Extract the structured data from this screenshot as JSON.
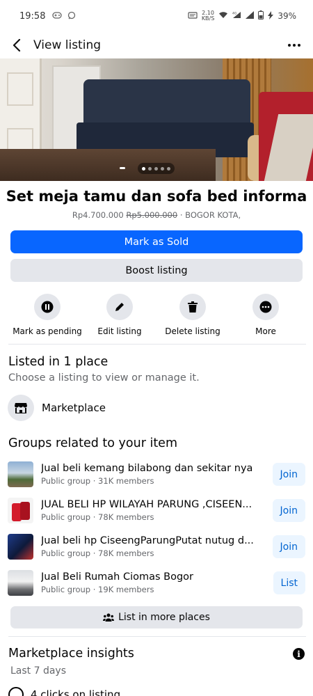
{
  "status_bar": {
    "time": "19:58",
    "net_speed_value": "2.10",
    "net_speed_unit": "KB/S",
    "battery": "39%"
  },
  "app_bar": {
    "title": "View listing"
  },
  "listing": {
    "title": "Set meja tamu dan sofa bed informa",
    "price": "Rp4.700.000",
    "old_price": "Rp5.000.000",
    "location": "· BOGOR KOTA,",
    "photo_count": 5,
    "current_photo": 1
  },
  "buttons": {
    "mark_sold": "Mark as Sold",
    "boost": "Boost listing",
    "list_more": "List in more places"
  },
  "actions": [
    {
      "label": "Mark as pending",
      "icon": "pause-icon"
    },
    {
      "label": "Edit listing",
      "icon": "pencil-icon"
    },
    {
      "label": "Delete listing",
      "icon": "trash-icon"
    },
    {
      "label": "More",
      "icon": "more-dots-icon"
    }
  ],
  "listed_section": {
    "title": "Listed in 1 place",
    "subtitle": "Choose a listing to view or manage it.",
    "place": "Marketplace"
  },
  "groups_section": {
    "title": "Groups related to your item",
    "groups": [
      {
        "name": "Jual beli kemang bilabong dan sekitar nya",
        "meta": "Public group · 31K members",
        "action": "Join"
      },
      {
        "name": "JUAL BELI HP WILAYAH PARUNG ,CISEEN...",
        "meta": "Public group · 78K members",
        "action": "Join"
      },
      {
        "name": "Jual beli hp CiseengParungPutat nutug d...",
        "meta": "Public group · 78K members",
        "action": "Join"
      },
      {
        "name": "Jual Beli Rumah Ciomas Bogor",
        "meta": "Public group · 19K members",
        "action": "List"
      }
    ]
  },
  "insights": {
    "title": "Marketplace insights",
    "period": "Last 7 days",
    "clicks": "4 clicks on listing"
  },
  "colors": {
    "primary": "#0866ff",
    "secondary_bg": "#e4e6eb",
    "join_bg": "#ebf5ff",
    "join_text": "#0064d1"
  }
}
